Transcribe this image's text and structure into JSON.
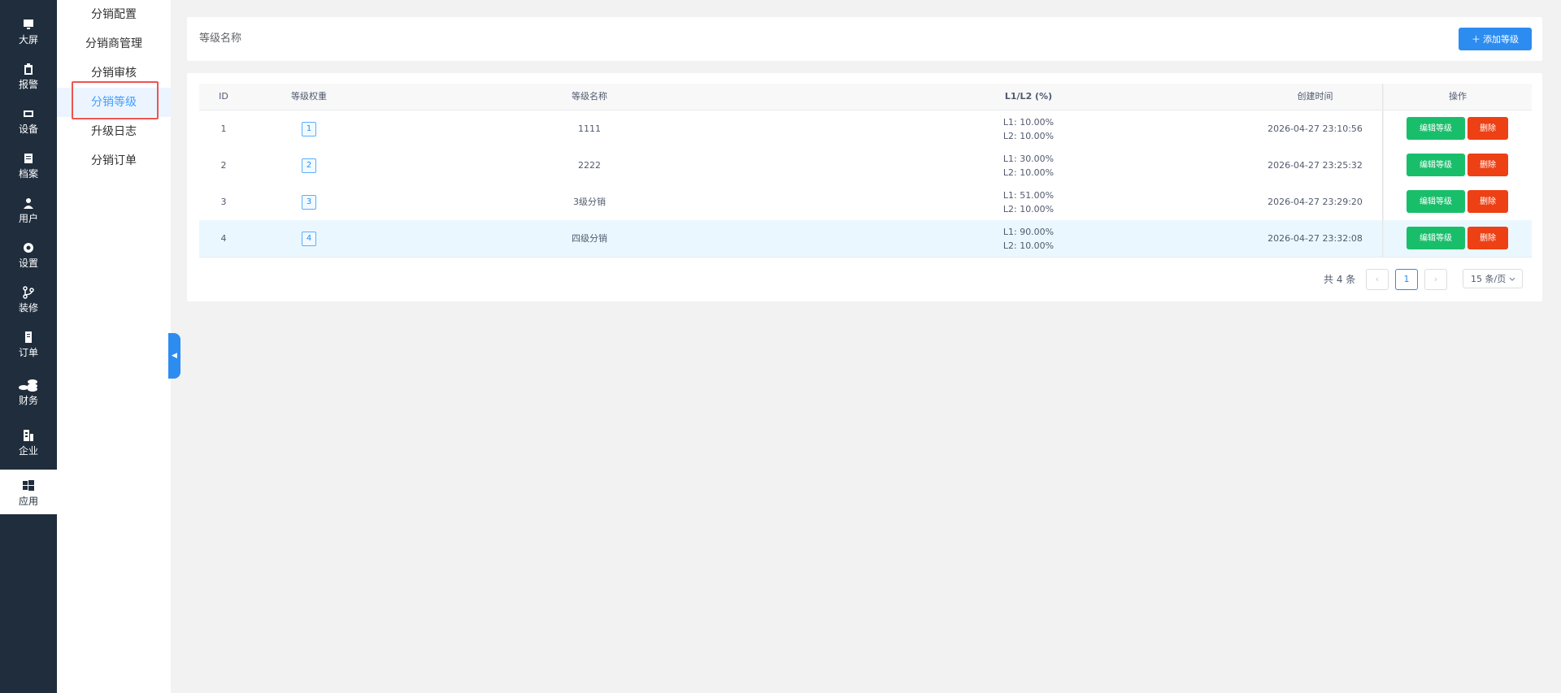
{
  "rail": {
    "items": [
      {
        "label": "大屏",
        "icon": "monitor-icon"
      },
      {
        "label": "报警",
        "icon": "clipboard-icon"
      },
      {
        "label": "设备",
        "icon": "device-icon"
      },
      {
        "label": "档案",
        "icon": "file-icon"
      },
      {
        "label": "用户",
        "icon": "user-icon"
      },
      {
        "label": "设置",
        "icon": "gear-icon"
      },
      {
        "label": "装修",
        "icon": "branch-icon"
      },
      {
        "label": "订单",
        "icon": "order-icon"
      },
      {
        "label": "财务",
        "icon": "coins-icon"
      },
      {
        "label": "企业",
        "icon": "building-icon"
      },
      {
        "label": "应用",
        "icon": "windows-icon"
      }
    ],
    "active_index": 10
  },
  "submenu": {
    "items": [
      "分销配置",
      "分销商管理",
      "分销审核",
      "分销等级",
      "升级日志",
      "分销订单"
    ],
    "active_index": 3
  },
  "toolbar": {
    "title": "等级名称",
    "add_label": "＋ 添加等级"
  },
  "table": {
    "headers": {
      "id": "ID",
      "weight": "等级权重",
      "name": "等级名称",
      "ratio": "L1/L2 (%)",
      "created": "创建时间",
      "ops": "操作"
    },
    "rows": [
      {
        "id": "1",
        "weight": "1",
        "name": "1111",
        "l1": "L1: 10.00%",
        "l2": "L2: 10.00%",
        "created": "2026-04-27 23:10:56",
        "edit": "编辑等级",
        "delete": "删除"
      },
      {
        "id": "2",
        "weight": "2",
        "name": "2222",
        "l1": "L1: 30.00%",
        "l2": "L2: 10.00%",
        "created": "2026-04-27 23:25:32",
        "edit": "编辑等级",
        "delete": "删除"
      },
      {
        "id": "3",
        "weight": "3",
        "name": "3级分销",
        "l1": "L1: 51.00%",
        "l2": "L2: 10.00%",
        "created": "2026-04-27 23:29:20",
        "edit": "编辑等级",
        "delete": "删除"
      },
      {
        "id": "4",
        "weight": "4",
        "name": "四级分销",
        "l1": "L1: 90.00%",
        "l2": "L2: 10.00%",
        "created": "2026-04-27 23:32:08",
        "edit": "编辑等级",
        "delete": "删除"
      }
    ]
  },
  "pagination": {
    "total": "共 4 条",
    "prev": "‹",
    "current": "1",
    "next": "›",
    "page_size": "15 条/页"
  },
  "colors": {
    "primary": "#2d8cf0",
    "success": "#19be6b",
    "danger": "#ed4014",
    "rail_bg": "#1f2d3d"
  }
}
